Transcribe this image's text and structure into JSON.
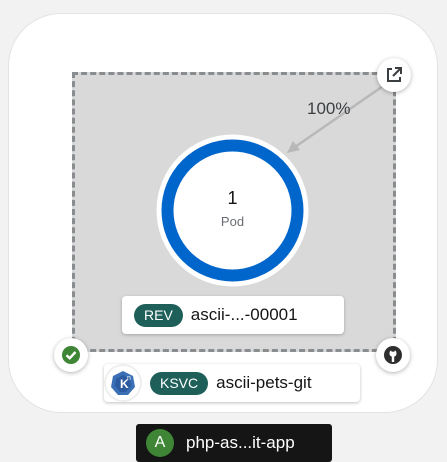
{
  "revision": {
    "badge": "REV",
    "name": "ascii-...-00001",
    "traffic_percent": "100%"
  },
  "pod_ring": {
    "count": "1",
    "label": "Pod",
    "ring_color": "#0066cc"
  },
  "service": {
    "badge": "KSVC",
    "name": "ascii-pets-git",
    "icon": "knative-icon"
  },
  "decorators": {
    "open_url_icon": "external-link-icon",
    "status_icon": "check-circle-icon",
    "status_color": "#3e8635",
    "source_icon": "github-icon"
  },
  "application": {
    "badge": "A",
    "name": "php-as...it-app"
  },
  "colors": {
    "badge_bg": "#1e5f5a",
    "app_badge_bg": "#3e8635",
    "app_label_bg": "#151515"
  }
}
